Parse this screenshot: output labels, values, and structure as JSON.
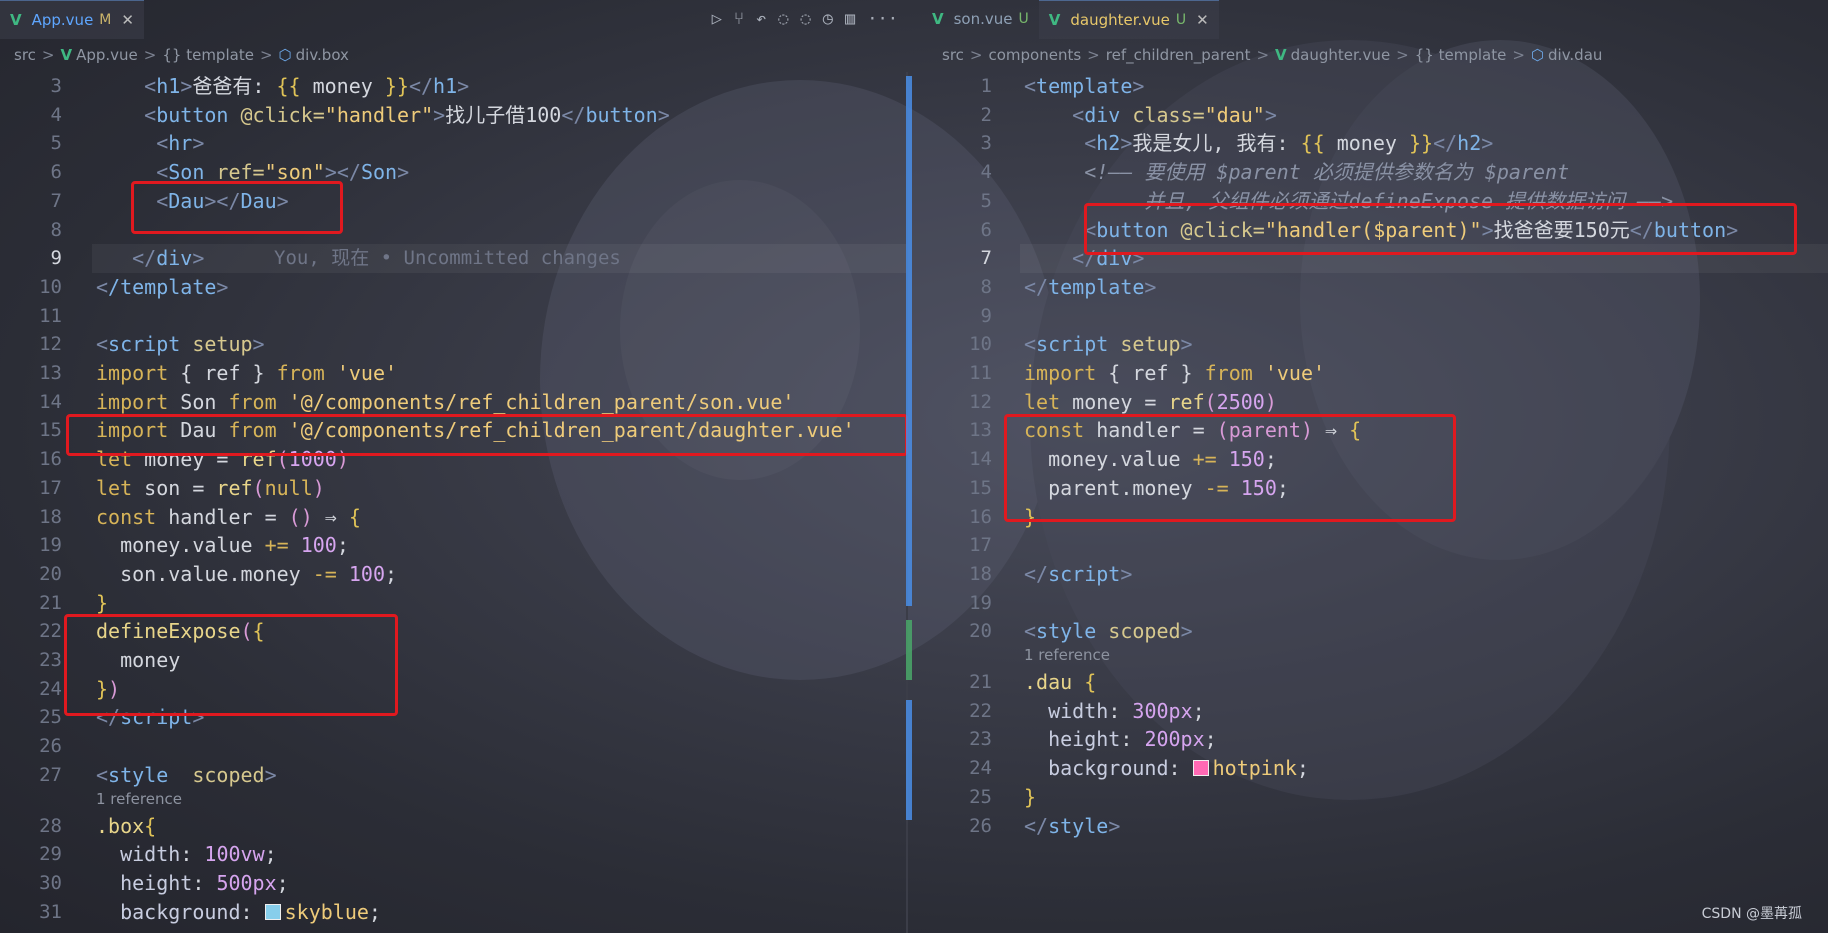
{
  "left": {
    "tabs": [
      {
        "name": "App.vue",
        "status": "M"
      }
    ],
    "toolbar_icons": [
      "run-icon",
      "source-control-icon",
      "go-back-icon",
      "go-prev-icon",
      "go-next-icon",
      "timeline-icon",
      "split-editor-icon",
      "more-icon"
    ],
    "breadcrumb": [
      "src",
      "App.vue",
      "{} template",
      "div.box"
    ],
    "lines": [
      {
        "n": "3",
        "code": [
          [
            "    "
          ],
          [
            "<",
            "ang"
          ],
          [
            "h1",
            "tag"
          ],
          [
            ">",
            "ang"
          ],
          [
            "爸爸有: "
          ],
          [
            "{{",
            "brace"
          ],
          [
            " money "
          ],
          [
            "}}",
            "brace"
          ],
          [
            "</",
            "ang"
          ],
          [
            "h1",
            "tag"
          ],
          [
            ">",
            "ang"
          ]
        ]
      },
      {
        "n": "4",
        "code": [
          [
            "    "
          ],
          [
            "<",
            "ang"
          ],
          [
            "button",
            "tag"
          ],
          [
            " @click=",
            "attr"
          ],
          [
            "\"handler\"",
            "str"
          ],
          [
            ">",
            "ang"
          ],
          [
            "找儿子借100"
          ],
          [
            "</",
            "ang"
          ],
          [
            "button",
            "tag"
          ],
          [
            ">",
            "ang"
          ]
        ]
      },
      {
        "n": "5",
        "code": [
          [
            "     "
          ],
          [
            "<",
            "ang"
          ],
          [
            "hr",
            "tag"
          ],
          [
            ">",
            "ang"
          ]
        ]
      },
      {
        "n": "6",
        "code": [
          [
            "     "
          ],
          [
            "<",
            "ang"
          ],
          [
            "Son",
            "tag"
          ],
          [
            " ref=",
            "attr"
          ],
          [
            "\"son\"",
            "str"
          ],
          [
            "></",
            "ang"
          ],
          [
            "Son",
            "tag"
          ],
          [
            ">",
            "ang"
          ]
        ]
      },
      {
        "n": "7",
        "code": [
          [
            "     "
          ],
          [
            "<",
            "ang"
          ],
          [
            "Dau",
            "tag"
          ],
          [
            "></",
            "ang"
          ],
          [
            "Dau",
            "tag"
          ],
          [
            ">",
            "ang"
          ]
        ]
      },
      {
        "n": "8",
        "code": [
          [
            ""
          ]
        ]
      },
      {
        "n": "9",
        "code": [
          [
            "   "
          ],
          [
            "</",
            "ang"
          ],
          [
            "div",
            "tag"
          ],
          [
            ">",
            "ang"
          ]
        ],
        "blame": "You, 现在 • Uncommitted changes",
        "cur": true
      },
      {
        "n": "10",
        "code": [
          [
            "<",
            "ang"
          ],
          [
            "/template",
            "tag"
          ],
          [
            ">",
            "ang"
          ]
        ]
      },
      {
        "n": "11",
        "code": [
          [
            ""
          ]
        ]
      },
      {
        "n": "12",
        "code": [
          [
            "<",
            "ang"
          ],
          [
            "script",
            "tag"
          ],
          [
            " setup",
            "attr"
          ],
          [
            ">",
            "ang"
          ]
        ]
      },
      {
        "n": "13",
        "code": [
          [
            "import",
            "kw"
          ],
          [
            " { ref } "
          ],
          [
            "from",
            "kw"
          ],
          [
            " 'vue'",
            "str"
          ]
        ]
      },
      {
        "n": "14",
        "code": [
          [
            "import",
            "kw"
          ],
          [
            " Son "
          ],
          [
            "from",
            "kw"
          ],
          [
            " '@/components/ref_children_parent/son.vue'",
            "str"
          ]
        ]
      },
      {
        "n": "15",
        "code": [
          [
            "import",
            "kw"
          ],
          [
            " Dau "
          ],
          [
            "from",
            "kw"
          ],
          [
            " '@/components/ref_children_parent/daughter.vue'",
            "str"
          ]
        ]
      },
      {
        "n": "16",
        "code": [
          [
            "let",
            "kw"
          ],
          [
            " money = "
          ],
          [
            "ref",
            "fn"
          ],
          [
            "(",
            "paren"
          ],
          [
            "1000",
            "num"
          ],
          [
            ")",
            "paren"
          ]
        ]
      },
      {
        "n": "17",
        "code": [
          [
            "let",
            "kw"
          ],
          [
            " son = "
          ],
          [
            "ref",
            "fn"
          ],
          [
            "(",
            "paren"
          ],
          [
            "null",
            "kw"
          ],
          [
            ")",
            "paren"
          ]
        ]
      },
      {
        "n": "18",
        "code": [
          [
            "const",
            "kw"
          ],
          [
            " handler = "
          ],
          [
            "()",
            "paren"
          ],
          [
            " ⇒ "
          ],
          [
            "{",
            "brace"
          ]
        ]
      },
      {
        "n": "19",
        "code": [
          [
            "  money.value "
          ],
          [
            "+=",
            "kw"
          ],
          [
            " "
          ],
          [
            "100",
            "num"
          ],
          [
            ";"
          ]
        ]
      },
      {
        "n": "20",
        "code": [
          [
            "  son.value.money "
          ],
          [
            "-=",
            "kw"
          ],
          [
            " "
          ],
          [
            "100",
            "num"
          ],
          [
            ";"
          ]
        ]
      },
      {
        "n": "21",
        "code": [
          [
            "}",
            "brace"
          ]
        ]
      },
      {
        "n": "22",
        "code": [
          [
            "defineExpose",
            "fn"
          ],
          [
            "(",
            "paren"
          ],
          [
            "{",
            "brace"
          ]
        ]
      },
      {
        "n": "23",
        "code": [
          [
            "  money"
          ]
        ]
      },
      {
        "n": "24",
        "code": [
          [
            "}",
            "brace"
          ],
          [
            ")",
            "paren"
          ]
        ]
      },
      {
        "n": "25",
        "code": [
          [
            "</",
            "ang"
          ],
          [
            "script",
            "tag"
          ],
          [
            ">",
            "ang"
          ]
        ]
      },
      {
        "n": "26",
        "code": [
          [
            ""
          ]
        ]
      },
      {
        "n": "27",
        "code": [
          [
            "<",
            "ang"
          ],
          [
            "style",
            "tag"
          ],
          [
            "  scoped",
            "attr"
          ],
          [
            ">",
            "ang"
          ]
        ],
        "hint": "1 reference"
      },
      {
        "n": "28",
        "code": [
          [
            ".box",
            "fn"
          ],
          [
            "{",
            "brace"
          ]
        ]
      },
      {
        "n": "29",
        "code": [
          [
            "  "
          ],
          [
            "width",
            "prop"
          ],
          [
            ": "
          ],
          [
            "100vw",
            "num"
          ],
          [
            ";"
          ]
        ]
      },
      {
        "n": "30",
        "code": [
          [
            "  "
          ],
          [
            "height",
            "prop"
          ],
          [
            ": "
          ],
          [
            "500px",
            "num"
          ],
          [
            ";"
          ]
        ]
      },
      {
        "n": "31",
        "code": [
          [
            "  "
          ],
          [
            "background",
            "prop"
          ],
          [
            ": "
          ],
          [
            "SW:#87ceeb"
          ],
          [
            "skyblue",
            "str"
          ],
          [
            ";"
          ]
        ]
      }
    ]
  },
  "right": {
    "tabs": [
      {
        "name": "son.vue",
        "status": "U"
      },
      {
        "name": "daughter.vue",
        "status": "U"
      }
    ],
    "breadcrumb": [
      "src",
      "components",
      "ref_children_parent",
      "daughter.vue",
      "{} template",
      "div.dau"
    ],
    "lines": [
      {
        "n": "1",
        "code": [
          [
            "<",
            "ang"
          ],
          [
            "template",
            "tag"
          ],
          [
            ">",
            "ang"
          ]
        ]
      },
      {
        "n": "2",
        "code": [
          [
            "    "
          ],
          [
            "<",
            "ang"
          ],
          [
            "div",
            "tag"
          ],
          [
            " class=",
            "attr"
          ],
          [
            "\"dau\"",
            "str"
          ],
          [
            ">",
            "ang"
          ]
        ]
      },
      {
        "n": "3",
        "code": [
          [
            "     "
          ],
          [
            "<",
            "ang"
          ],
          [
            "h2",
            "tag"
          ],
          [
            ">",
            "ang"
          ],
          [
            "我是女儿, 我有: "
          ],
          [
            "{{",
            "brace"
          ],
          [
            " money "
          ],
          [
            "}}",
            "brace"
          ],
          [
            "</",
            "ang"
          ],
          [
            "h2",
            "tag"
          ],
          [
            ">",
            "ang"
          ]
        ]
      },
      {
        "n": "4",
        "code": [
          [
            "     "
          ],
          [
            "<!—— 要使用 $parent 必须提供参数名为 $parent",
            "cmt"
          ]
        ]
      },
      {
        "n": "5",
        "code": [
          [
            "          "
          ],
          [
            "并且, 父组件必须通过defineExpose 提供数据访问 ——>",
            "cmt"
          ]
        ]
      },
      {
        "n": "6",
        "code": [
          [
            "     "
          ],
          [
            "<",
            "ang"
          ],
          [
            "button",
            "tag"
          ],
          [
            " @click=",
            "attr"
          ],
          [
            "\"handler($parent)\"",
            "str"
          ],
          [
            ">",
            "ang"
          ],
          [
            "找爸爸要150元"
          ],
          [
            "</",
            "ang"
          ],
          [
            "button",
            "tag"
          ],
          [
            ">",
            "ang"
          ]
        ]
      },
      {
        "n": "7",
        "code": [
          [
            "    "
          ],
          [
            "</",
            "ang"
          ],
          [
            "div",
            "tag"
          ],
          [
            ">",
            "ang"
          ]
        ],
        "cur": true
      },
      {
        "n": "8",
        "code": [
          [
            "</",
            "ang"
          ],
          [
            "template",
            "tag"
          ],
          [
            ">",
            "ang"
          ]
        ]
      },
      {
        "n": "9",
        "code": [
          [
            ""
          ]
        ]
      },
      {
        "n": "10",
        "code": [
          [
            "<",
            "ang"
          ],
          [
            "script",
            "tag"
          ],
          [
            " setup",
            "attr"
          ],
          [
            ">",
            "ang"
          ]
        ]
      },
      {
        "n": "11",
        "code": [
          [
            "import",
            "kw"
          ],
          [
            " { ref } "
          ],
          [
            "from",
            "kw"
          ],
          [
            " 'vue'",
            "str"
          ]
        ]
      },
      {
        "n": "12",
        "code": [
          [
            "let",
            "kw"
          ],
          [
            " money = "
          ],
          [
            "ref",
            "fn"
          ],
          [
            "(",
            "paren"
          ],
          [
            "2500",
            "num"
          ],
          [
            ")",
            "paren"
          ]
        ]
      },
      {
        "n": "13",
        "code": [
          [
            "const",
            "kw"
          ],
          [
            " handler = "
          ],
          [
            "(parent)",
            "paren"
          ],
          [
            " ⇒ "
          ],
          [
            "{",
            "brace"
          ]
        ]
      },
      {
        "n": "14",
        "code": [
          [
            "  money.value "
          ],
          [
            "+=",
            "kw"
          ],
          [
            " "
          ],
          [
            "150",
            "num"
          ],
          [
            ";"
          ]
        ]
      },
      {
        "n": "15",
        "code": [
          [
            "  parent.money "
          ],
          [
            "-=",
            "kw"
          ],
          [
            " "
          ],
          [
            "150",
            "num"
          ],
          [
            ";"
          ]
        ]
      },
      {
        "n": "16",
        "code": [
          [
            "}",
            "brace"
          ]
        ]
      },
      {
        "n": "17",
        "code": [
          [
            ""
          ]
        ]
      },
      {
        "n": "18",
        "code": [
          [
            "</",
            "ang"
          ],
          [
            "script",
            "tag"
          ],
          [
            ">",
            "ang"
          ]
        ]
      },
      {
        "n": "19",
        "code": [
          [
            ""
          ]
        ]
      },
      {
        "n": "20",
        "code": [
          [
            "<",
            "ang"
          ],
          [
            "style",
            "tag"
          ],
          [
            " scoped",
            "attr"
          ],
          [
            ">",
            "ang"
          ]
        ],
        "hint": "1 reference"
      },
      {
        "n": "21",
        "code": [
          [
            ".dau",
            "fn"
          ],
          [
            " "
          ],
          [
            "{",
            "brace"
          ]
        ]
      },
      {
        "n": "22",
        "code": [
          [
            "  "
          ],
          [
            "width",
            "prop"
          ],
          [
            ": "
          ],
          [
            "300px",
            "num"
          ],
          [
            ";"
          ]
        ]
      },
      {
        "n": "23",
        "code": [
          [
            "  "
          ],
          [
            "height",
            "prop"
          ],
          [
            ": "
          ],
          [
            "200px",
            "num"
          ],
          [
            ";"
          ]
        ]
      },
      {
        "n": "24",
        "code": [
          [
            "  "
          ],
          [
            "background",
            "prop"
          ],
          [
            ": "
          ],
          [
            "SW:#ff69b4"
          ],
          [
            "hotpink",
            "str"
          ],
          [
            ";"
          ]
        ]
      },
      {
        "n": "25",
        "code": [
          [
            "}",
            "brace"
          ]
        ]
      },
      {
        "n": "26",
        "code": [
          [
            "</",
            "ang"
          ],
          [
            "style",
            "tag"
          ],
          [
            ">",
            "ang"
          ]
        ]
      }
    ]
  },
  "watermark": "CSDN @墨苒孤"
}
